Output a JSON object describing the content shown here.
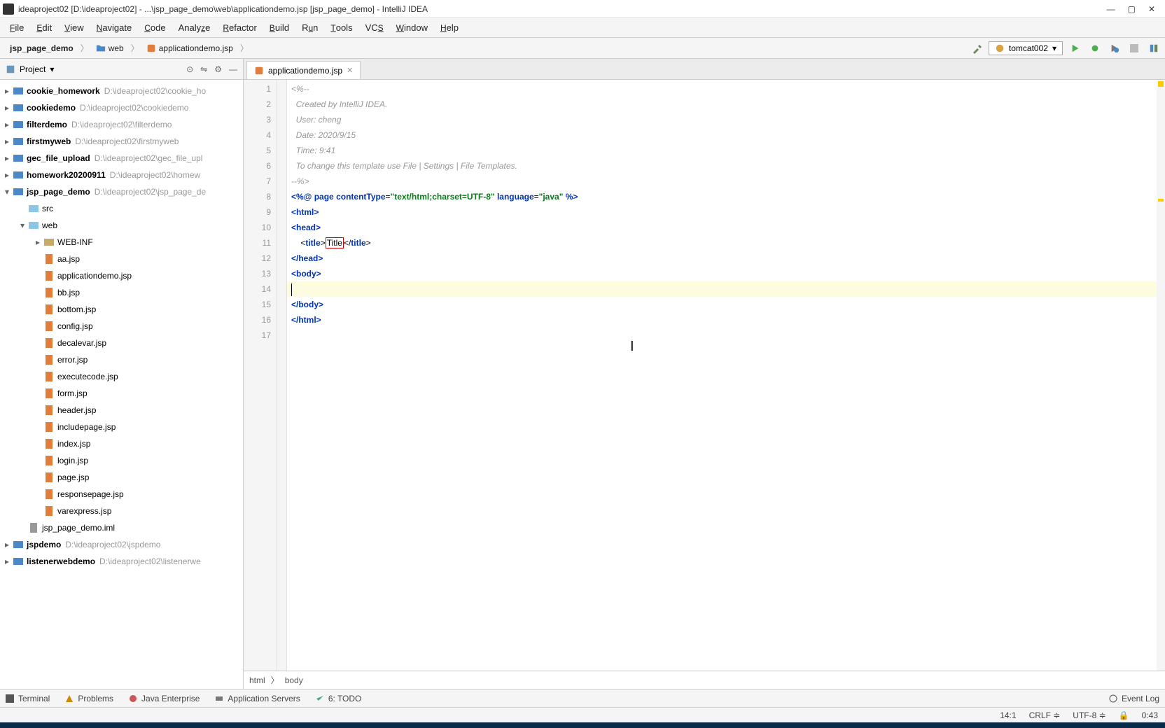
{
  "title": "ideaproject02 [D:\\ideaproject02] - ...\\jsp_page_demo\\web\\applicationdemo.jsp [jsp_page_demo] - IntelliJ IDEA",
  "menus": [
    "File",
    "Edit",
    "View",
    "Navigate",
    "Code",
    "Analyze",
    "Refactor",
    "Build",
    "Run",
    "Tools",
    "VCS",
    "Window",
    "Help"
  ],
  "breadcrumb": {
    "p0": "jsp_page_demo",
    "p1": "web",
    "p2": "applicationdemo.jsp"
  },
  "run_config": "tomcat002",
  "sidebar_title": "Project",
  "projects": [
    {
      "name": "cookie_homework",
      "path": "D:\\ideaproject02\\cookie_ho"
    },
    {
      "name": "cookiedemo",
      "path": "D:\\ideaproject02\\cookiedemo"
    },
    {
      "name": "filterdemo",
      "path": "D:\\ideaproject02\\filterdemo"
    },
    {
      "name": "firstmyweb",
      "path": "D:\\ideaproject02\\firstmyweb"
    },
    {
      "name": "gec_file_upload",
      "path": "D:\\ideaproject02\\gec_file_upl"
    },
    {
      "name": "homework20200911",
      "path": "D:\\ideaproject02\\homew"
    }
  ],
  "open_proj": {
    "name": "jsp_page_demo",
    "path": "D:\\ideaproject02\\jsp_page_de"
  },
  "src": "src",
  "web": "web",
  "webinf": "WEB-INF",
  "jsps": [
    "aa.jsp",
    "applicationdemo.jsp",
    "bb.jsp",
    "bottom.jsp",
    "config.jsp",
    "decalevar.jsp",
    "error.jsp",
    "executecode.jsp",
    "form.jsp",
    "header.jsp",
    "includepage.jsp",
    "index.jsp",
    "login.jsp",
    "page.jsp",
    "responsepage.jsp",
    "varexpress.jsp"
  ],
  "iml": "jsp_page_demo.iml",
  "more_projects": [
    {
      "name": "jspdemo",
      "path": "D:\\ideaproject02\\jspdemo"
    },
    {
      "name": "listenerwebdemo",
      "path": "D:\\ideaproject02\\listenerwe"
    }
  ],
  "tab_name": "applicationdemo.jsp",
  "code_lines": [
    "1",
    "2",
    "3",
    "4",
    "5",
    "6",
    "7",
    "8",
    "9",
    "10",
    "11",
    "12",
    "13",
    "14",
    "15",
    "16",
    "17"
  ],
  "c": {
    "l1": "<%--",
    "l2": "  Created by IntelliJ IDEA.",
    "l3": "  User: cheng",
    "l4": "  Date: 2020/9/15",
    "l5": "  Time: 9:41",
    "l6": "  To change this template use File | Settings | File Templates.",
    "l7": "--%>",
    "l8a": "<%@ ",
    "l8b": "page ",
    "l8c": "contentType",
    "l8d": "=",
    "l8e": "\"text/html;charset=UTF-8\" ",
    "l8f": "language",
    "l8g": "=",
    "l8h": "\"java\" ",
    "l8i": "%>",
    "l9": "<html>",
    "l10": "<head>",
    "l11a": "    <",
    "l11b": "title",
    "l11c": ">",
    "l11d": "Title",
    "l11e": "</",
    "l11f": "title",
    "l11g": ">",
    "l12": "</head>",
    "l13": "<body>",
    "l14": "",
    "l15": "</body>",
    "l16": "</html>",
    "l17": ""
  },
  "crumbs": {
    "a": "html",
    "b": "body"
  },
  "tool_tabs": [
    "Terminal",
    "Problems",
    "Java Enterprise",
    "Application Servers",
    "6: TODO"
  ],
  "event_log": "Event Log",
  "status": {
    "pos": "14:1",
    "crlf": "CRLF",
    "enc": "UTF-8",
    "time": "0:43"
  }
}
